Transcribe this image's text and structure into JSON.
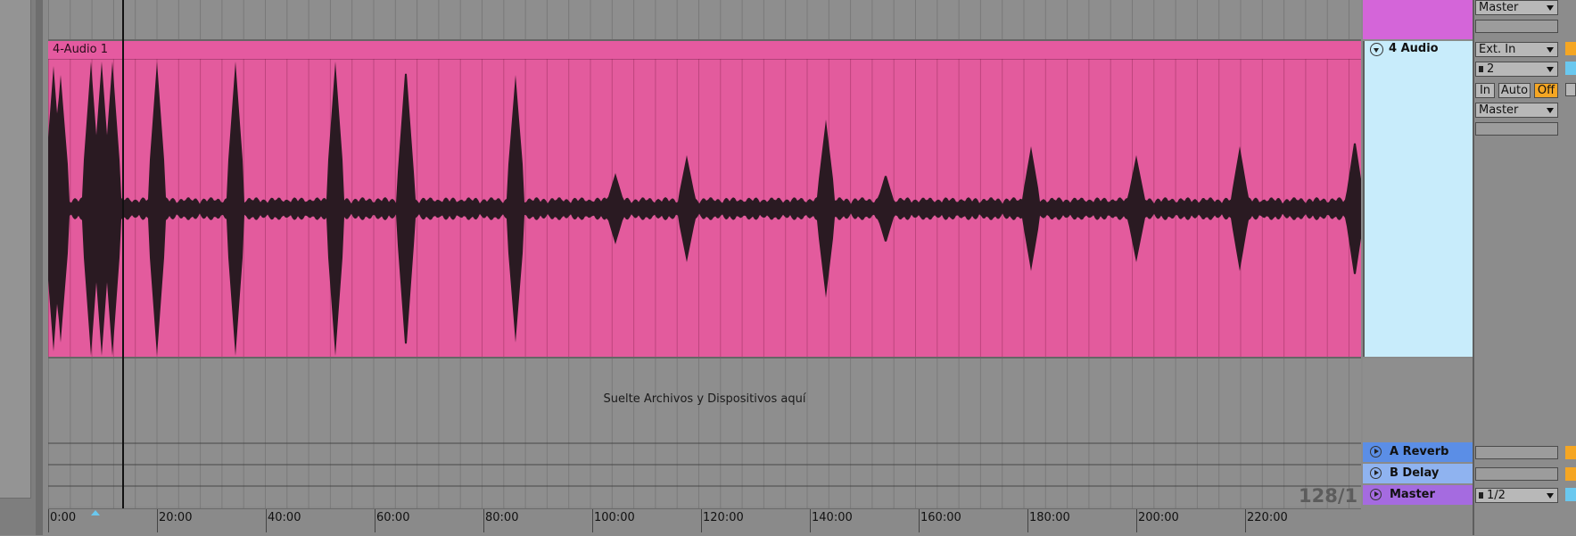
{
  "clip": {
    "name": "4-Audio 1"
  },
  "drop_zone": {
    "text": "Suelte Archivos y Dispositivos aquí"
  },
  "zoom": {
    "label": "128/1"
  },
  "ruler": {
    "labels": [
      "0:00",
      "20:00",
      "40:00",
      "60:00",
      "80:00",
      "100:00",
      "120:00",
      "140:00",
      "160:00",
      "180:00",
      "200:00",
      "220:00"
    ]
  },
  "tracks": {
    "top": {
      "color": "#d465d9",
      "output": "Master"
    },
    "audio": {
      "name": "4 Audio",
      "color": "#c8ecfb",
      "input_type": "Ext. In",
      "input_channel": "2",
      "monitor": [
        "In",
        "Auto",
        "Off"
      ],
      "monitor_active": "Off",
      "output": "Master"
    },
    "returns": [
      {
        "name": "A Reverb",
        "color": "#5b8ee6",
        "icon": "play-circle-icon"
      },
      {
        "name": "B Delay",
        "color": "#8fb3f0",
        "icon": "play-circle-icon"
      },
      {
        "name": "Master",
        "color": "#a56be0",
        "icon": "play-circle-icon",
        "output": "1/2"
      }
    ]
  },
  "colors": {
    "clip": "#e35b9d",
    "waveform": "#2a1a22",
    "monitor_active": "#f5a623",
    "accent_orange": "#f5a623",
    "accent_cyan": "#6ac8ef"
  }
}
